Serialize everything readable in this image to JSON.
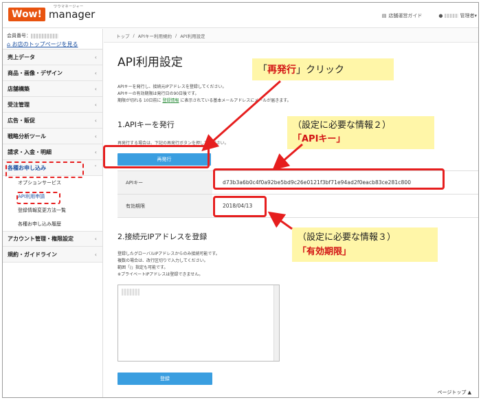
{
  "header": {
    "logo_wow": "Wow!",
    "logo_manager": "manager",
    "logo_ruby": "ワウマネージャー",
    "guide_link": "店舗運営ガイド",
    "admin_link": "管理者"
  },
  "sidebar": {
    "member_label": "会員番号：",
    "toplink": "お店のトップページを見る",
    "items": [
      {
        "label": "売上データ"
      },
      {
        "label": "商品・画像・デザイン"
      },
      {
        "label": "店舗構築"
      },
      {
        "label": "受注管理"
      },
      {
        "label": "広告・販促"
      },
      {
        "label": "戦略分析ツール"
      },
      {
        "label": "請求・入金・明細"
      },
      {
        "label": "各種お申し込み"
      }
    ],
    "subitems": [
      {
        "label": "オプションサービス"
      },
      {
        "label": "API利用申請"
      },
      {
        "label": "登録情報変更方法一覧"
      },
      {
        "label": "各種お申し込み履歴"
      }
    ],
    "items_bottom": [
      {
        "label": "アカウント管理・権限設定"
      },
      {
        "label": "規約・ガイドライン"
      }
    ]
  },
  "breadcrumb": {
    "home": "トップ",
    "sep": "/",
    "parent": "APIキー利用規約",
    "current": "API利用設定"
  },
  "page": {
    "title": "API利用設定",
    "desc1": "APIキーを発行し、接続元IPアドレスを登録してください。",
    "desc2": "APIキーの有効期限は発行日の90日後です。",
    "desc3_pre": "期限が切れる 10日前に ",
    "desc3_link": "登録情報",
    "desc3_post": " に表示されている基本メールアドレスにメールが届きます。",
    "section1_title": "1.APIキーを発行",
    "section1_note": "再発行する場合は、下記の再発行ボタンを押してください。",
    "reissue_button": "再発行",
    "apikey_label": "APIキー",
    "apikey_value": "d73b3a6b0c4f0a92be5bd9c26e0121f3bf71e94ad2f0eacb83ce281c800",
    "expiry_label": "有効期限",
    "expiry_value": "2018/04/13",
    "section2_title": "2.接続元IPアドレスを登録",
    "ip_desc1": "登録したグローバルIPアドレスからのみ接続可能です。",
    "ip_desc2": "複数の場合は、改行区切りで入力してください。",
    "ip_desc3": "範囲「/」指定も可能です。",
    "ip_desc4": "※プライベートIPアドレスは登録できません。",
    "register_button": "登録",
    "pagetop": "ページトップ ▲"
  },
  "annotations": {
    "callout1_pre": "「",
    "callout1_red": "再発行",
    "callout1_post": "」クリック",
    "callout2_line1": "（設定に必要な情報２）",
    "callout2_line2": "「APIキー」",
    "callout3_line1": "（設定に必要な情報３）",
    "callout3_line2": "「有効期限」",
    "highlight_color": "#e61e1e",
    "callout_color": "#fff6a8"
  }
}
